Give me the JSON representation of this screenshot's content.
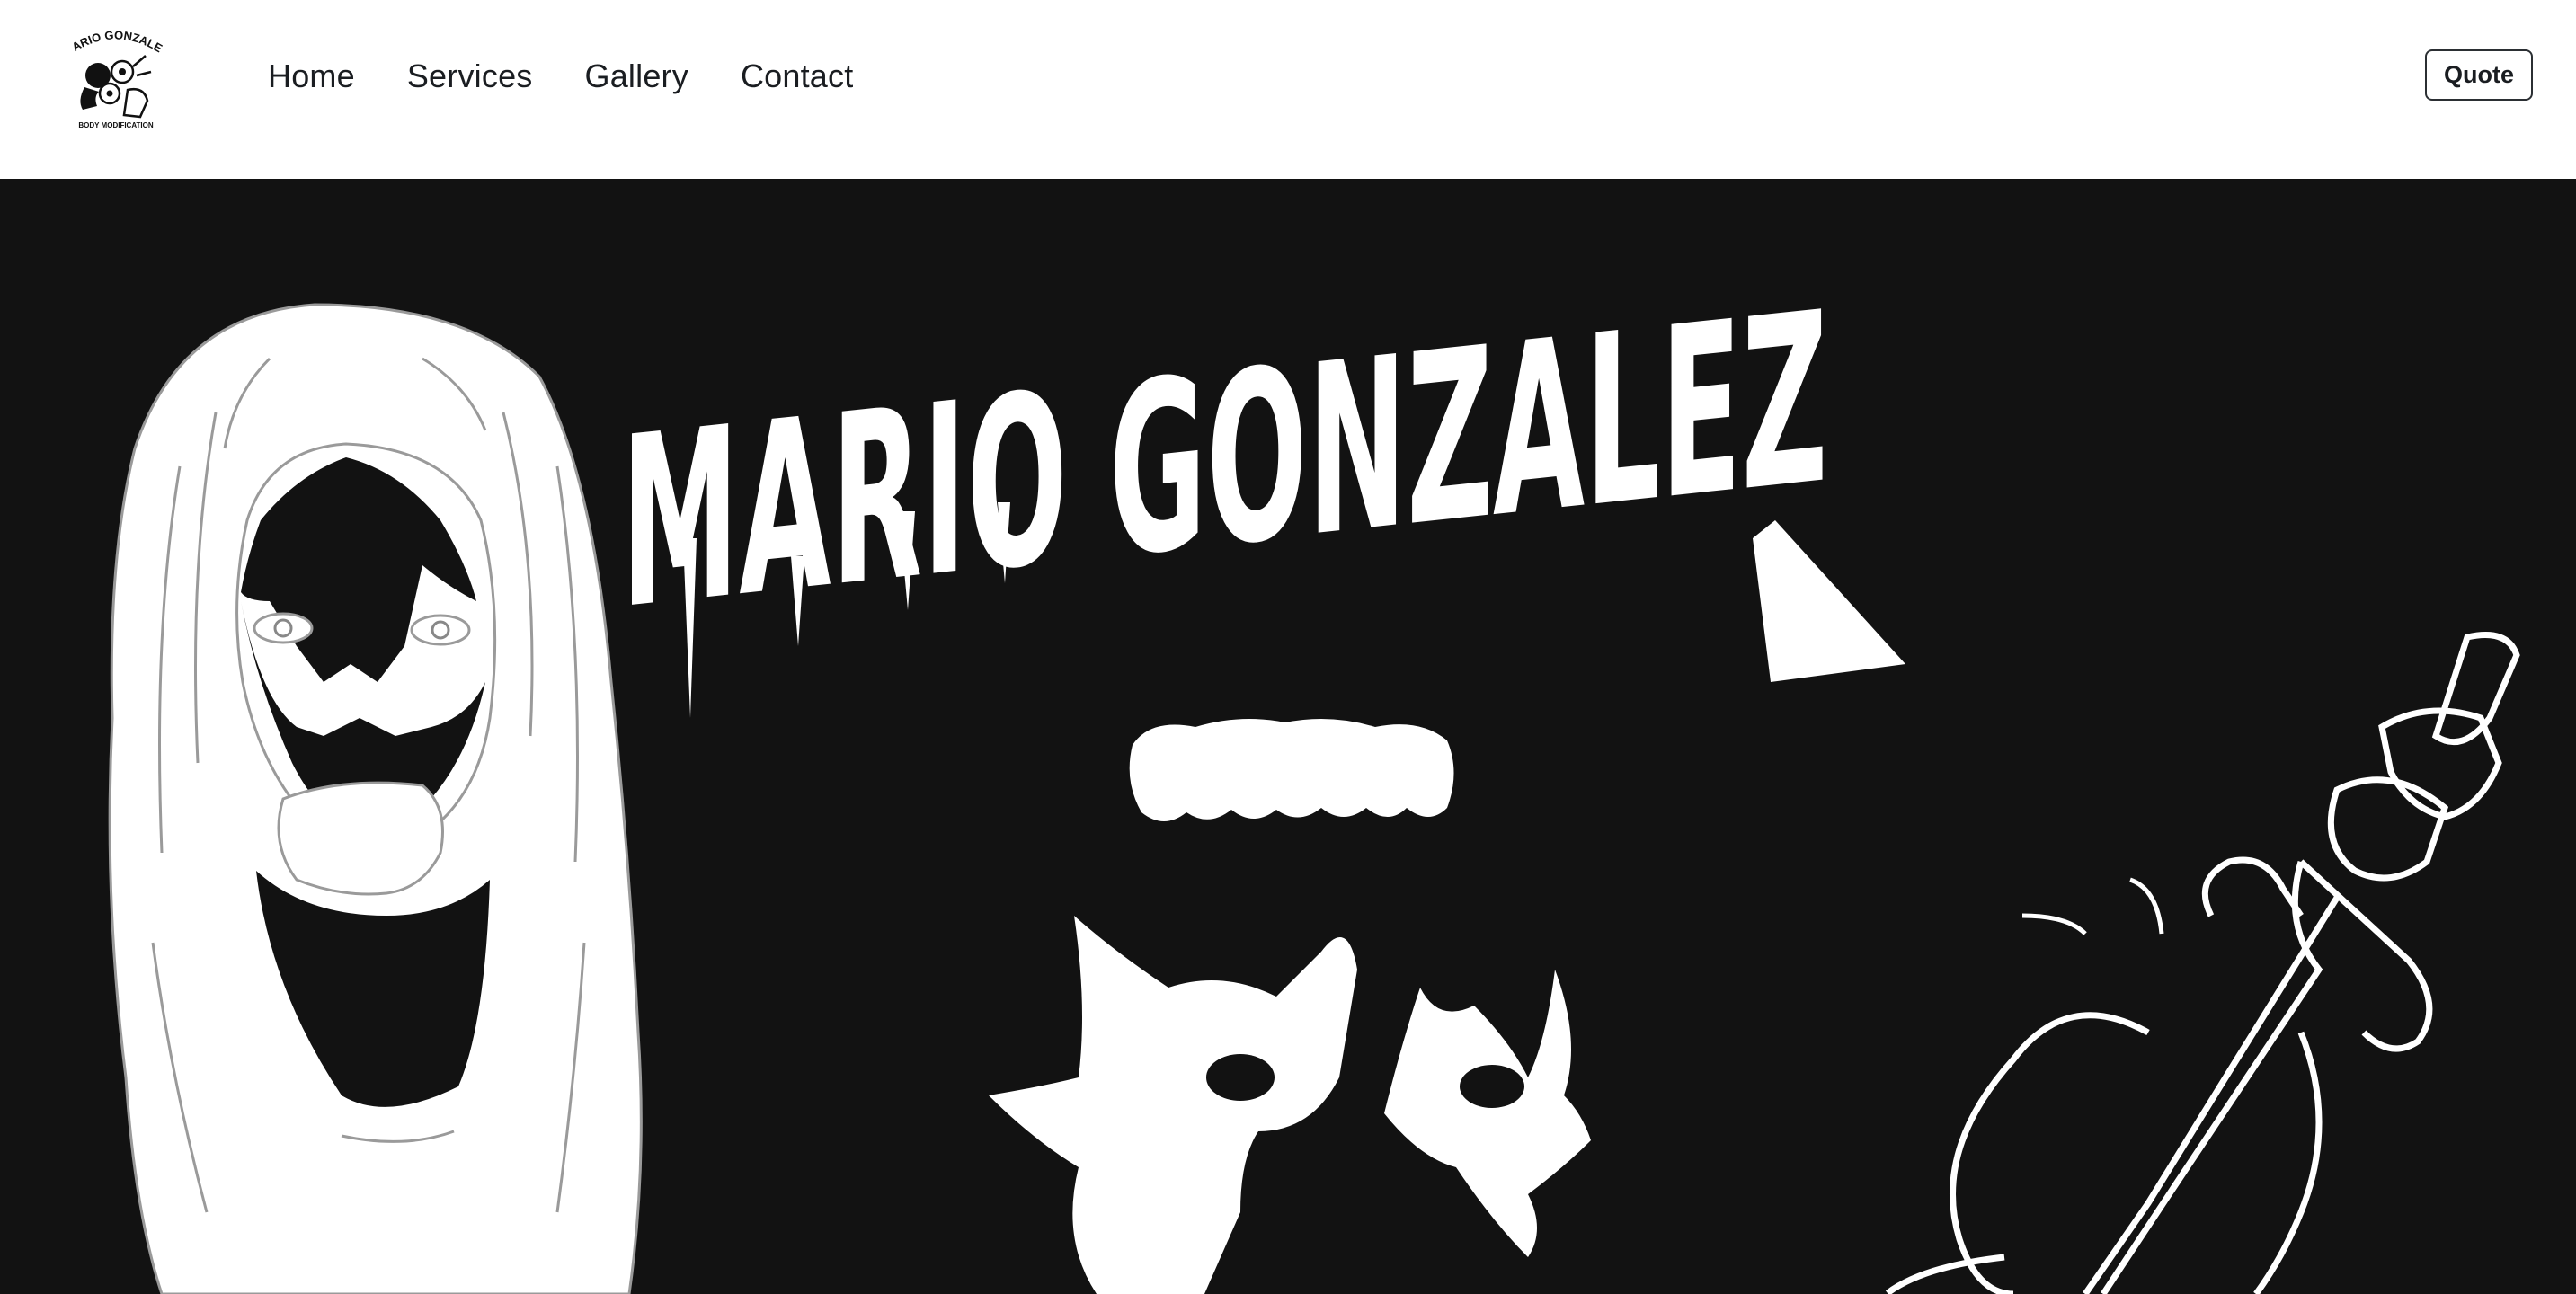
{
  "header": {
    "logo": {
      "icon": "mario-gonzalez-logo",
      "text_top": "MARIO GONZALEZ",
      "text_bottom": "BODY MODIFICATION"
    },
    "nav": [
      {
        "label": "Home"
      },
      {
        "label": "Services"
      },
      {
        "label": "Gallery"
      },
      {
        "label": "Contact"
      }
    ],
    "quote_label": "Quote"
  },
  "hero": {
    "title": "MARIO GONZALEZ",
    "background": "#121212",
    "illustrations": [
      "long-haired-face-icon",
      "teeth-grill-icon",
      "devil-horns-hands-icon",
      "dagger-heart-icon"
    ]
  },
  "colors": {
    "header_bg": "#ffffff",
    "nav_text": "#1a1d21",
    "hero_bg": "#121212",
    "art": "#ffffff"
  }
}
